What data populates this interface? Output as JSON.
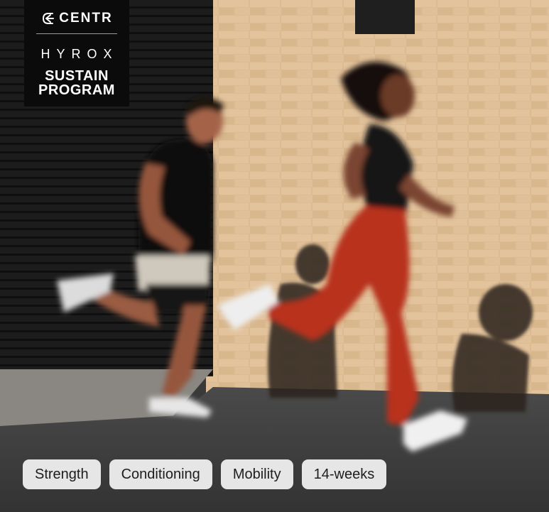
{
  "brand": {
    "name": "CENTR",
    "icon": "centr-logo-icon"
  },
  "program": {
    "label": "HYROX",
    "title_line1": "SUSTAIN",
    "title_line2": "PROGRAM"
  },
  "tags": [
    {
      "label": "Strength"
    },
    {
      "label": "Conditioning"
    },
    {
      "label": "Mobility"
    },
    {
      "label": "14-weeks"
    }
  ],
  "colors": {
    "badge_background": "#0b0b0b",
    "tag_background": "#e6e6e6",
    "tag_text": "#1d1d1d",
    "leggings": "#b8321f",
    "brick_wall": "#d9b88f"
  }
}
